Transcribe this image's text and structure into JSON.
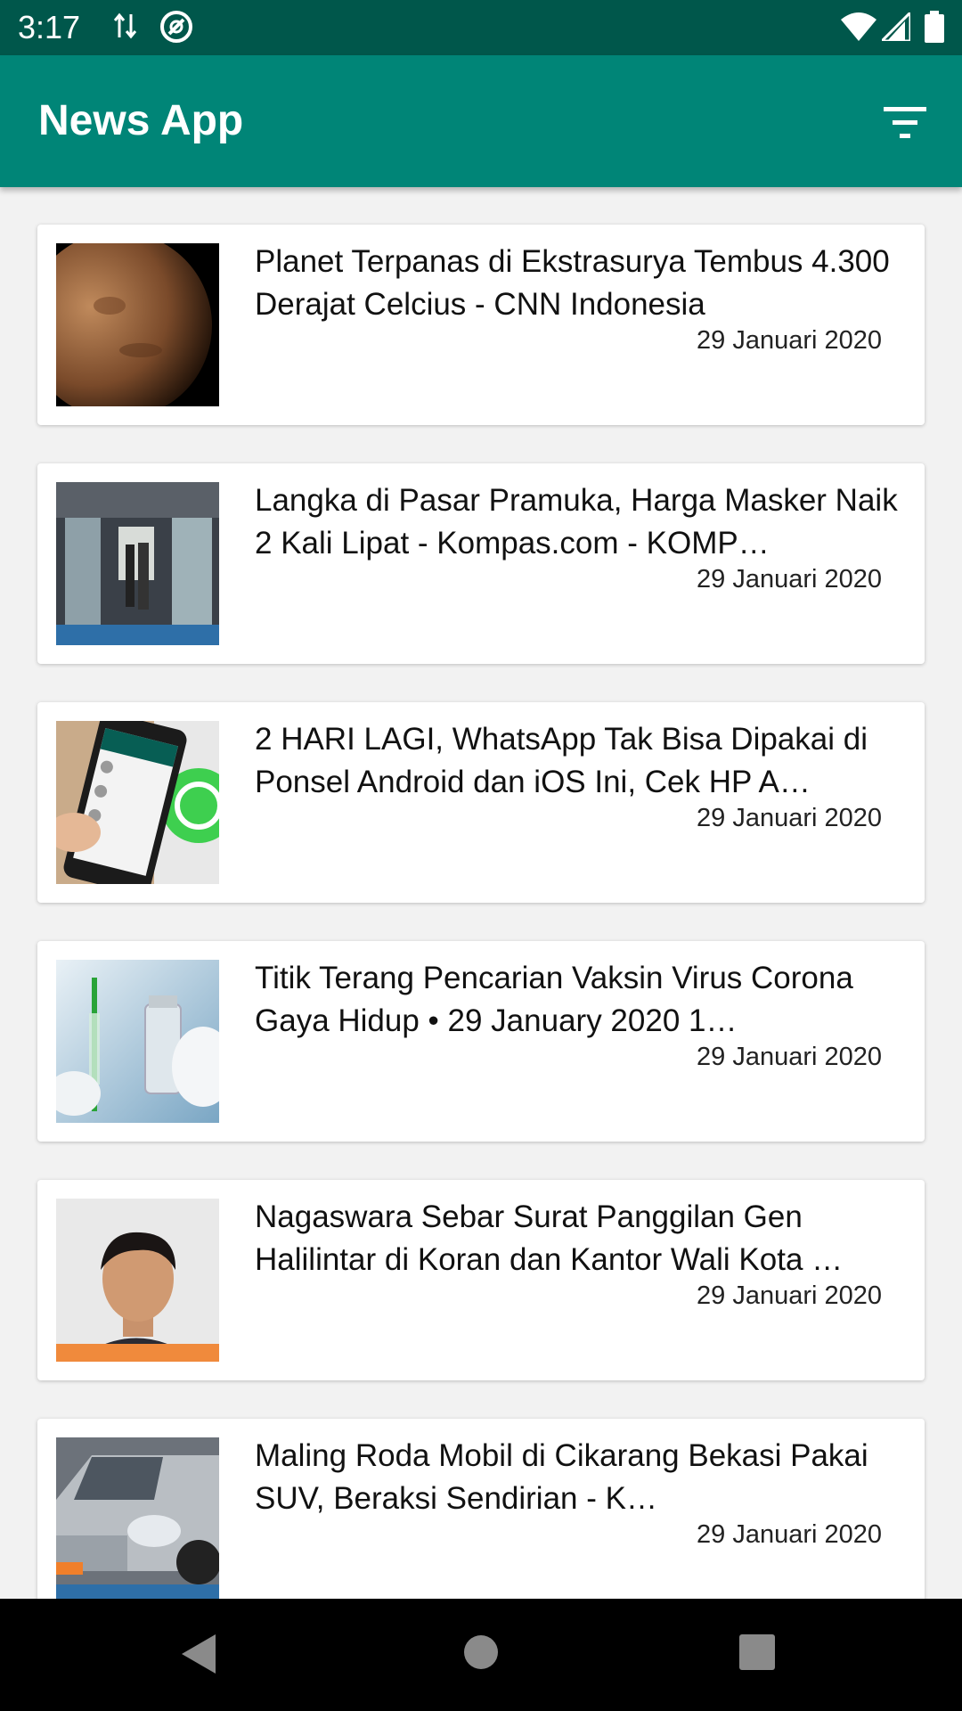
{
  "status_bar": {
    "time": "3:17",
    "icons": [
      "data-transfer-icon",
      "sync-icon",
      "wifi-icon",
      "signal-icon",
      "battery-icon"
    ]
  },
  "app_bar": {
    "title": "News App",
    "filter_icon": "filter-icon",
    "color": "#008577",
    "status_color": "#00574b"
  },
  "articles": [
    {
      "title": "Planet Terpanas di Ekstrasurya Tembus 4.300 Derajat Celcius - CNN Indonesia",
      "date": "29 Januari 2020",
      "thumbnail": "planet-image"
    },
    {
      "title": "Langka di Pasar Pramuka, Harga Masker Naik 2 Kali Lipat - Kompas.com - KOMP…",
      "date": "29 Januari 2020",
      "thumbnail": "market-image"
    },
    {
      "title": "2 HARI LAGI, WhatsApp Tak Bisa Dipakai di Ponsel Android dan iOS Ini, Cek HP A…",
      "date": "29 Januari 2020",
      "thumbnail": "whatsapp-phone-image"
    },
    {
      "title": "Titik Terang Pencarian Vaksin Virus Corona Gaya Hidup • 29 January 2020 1…",
      "date": "29 Januari 2020",
      "thumbnail": "vaccine-image"
    },
    {
      "title": "Nagaswara Sebar Surat Panggilan Gen Halilintar di Koran dan Kantor Wali Kota …",
      "date": "29 Januari 2020",
      "thumbnail": "portrait-image"
    },
    {
      "title": "Maling Roda Mobil di Cikarang Bekasi Pakai SUV, Beraksi Sendirian - K…",
      "date": "29 Januari 2020",
      "thumbnail": "car-image"
    }
  ],
  "nav_bar": {
    "back": "back-icon",
    "home": "home-icon",
    "recents": "recents-icon"
  }
}
